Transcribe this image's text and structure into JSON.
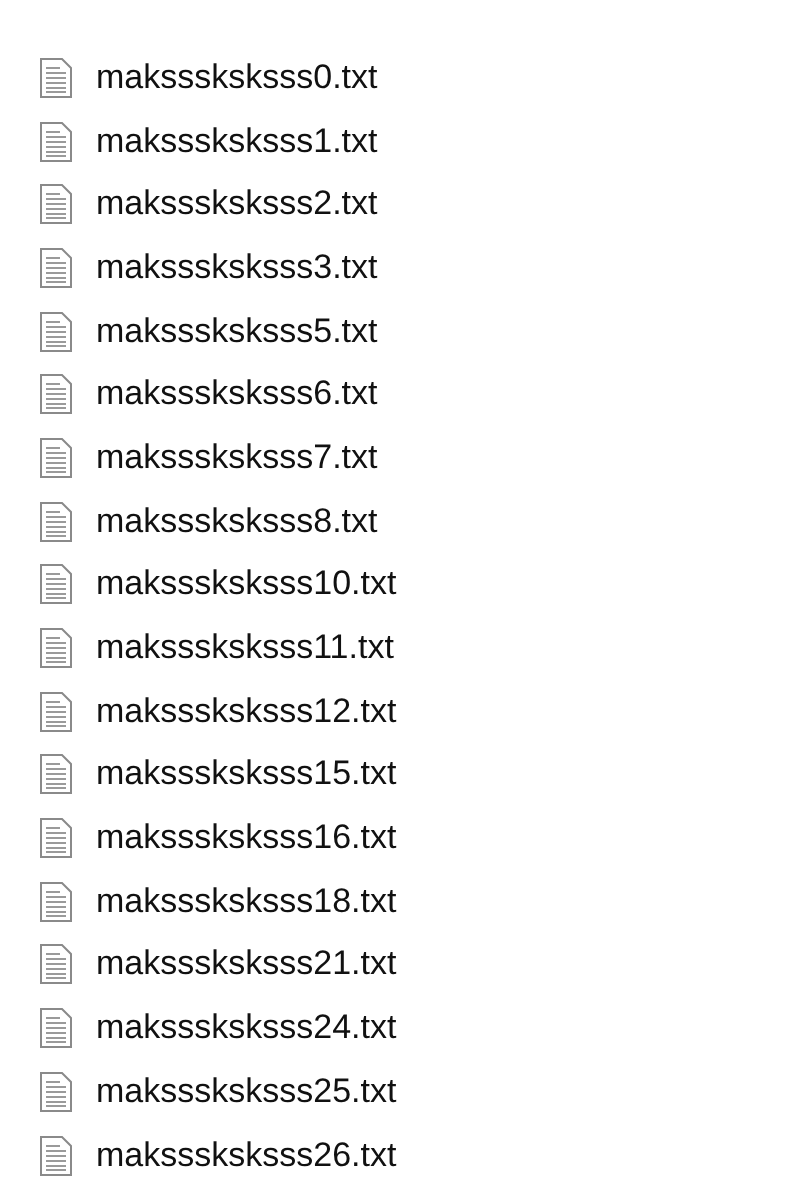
{
  "files": [
    {
      "name": "maksssksksss0.txt"
    },
    {
      "name": "maksssksksss1.txt"
    },
    {
      "name": "maksssksksss2.txt"
    },
    {
      "name": "maksssksksss3.txt"
    },
    {
      "name": "maksssksksss5.txt"
    },
    {
      "name": "maksssksksss6.txt"
    },
    {
      "name": "maksssksksss7.txt"
    },
    {
      "name": "maksssksksss8.txt"
    },
    {
      "name": "maksssksksss10.txt"
    },
    {
      "name": "maksssksksss11.txt"
    },
    {
      "name": "maksssksksss12.txt"
    },
    {
      "name": "maksssksksss15.txt"
    },
    {
      "name": "maksssksksss16.txt"
    },
    {
      "name": "maksssksksss18.txt"
    },
    {
      "name": "maksssksksss21.txt"
    },
    {
      "name": "maksssksksss24.txt"
    },
    {
      "name": "maksssksksss25.txt"
    },
    {
      "name": "maksssksksss26.txt"
    }
  ]
}
